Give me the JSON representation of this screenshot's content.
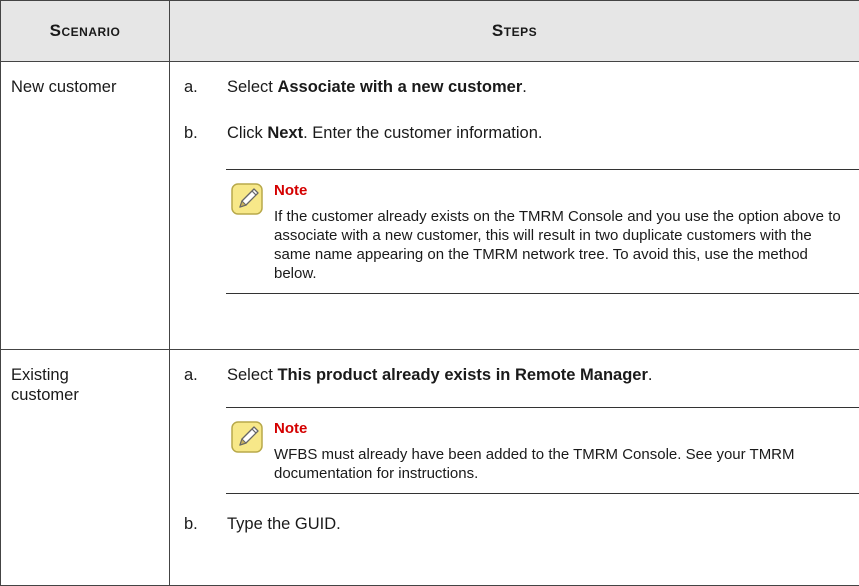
{
  "table": {
    "headers": {
      "scenario": "Scenario",
      "steps": "Steps"
    },
    "rows": [
      {
        "scenario": "New customer",
        "step_a": {
          "letter": "a.",
          "pre": "Select ",
          "bold": "Associate with a new customer",
          "post": "."
        },
        "step_b": {
          "letter": "b.",
          "pre": "Click ",
          "bold": "Next",
          "post": ". Enter the customer information."
        },
        "note": {
          "icon": "note-pencil-icon",
          "title": "Note",
          "body": "If the customer already exists on the TMRM Console and you use the option above to associate with a new customer, this will result in two duplicate customers with the same name appearing on the TMRM network tree. To avoid this, use the method below."
        }
      },
      {
        "scenario": "Existing customer",
        "step_a": {
          "letter": "a.",
          "pre": "Select ",
          "bold": "This product already exists in Remote Manager",
          "post": "."
        },
        "note": {
          "icon": "note-pencil-icon",
          "title": "Note",
          "body": "WFBS must already have been added to the TMRM Console. See your TMRM documentation for instructions."
        },
        "step_b": {
          "letter": "b.",
          "text": "Type the GUID."
        }
      }
    ]
  },
  "colors": {
    "header_bg": "#e6e6e6",
    "note_title": "#d40000",
    "note_icon_fill": "#f7e889"
  }
}
